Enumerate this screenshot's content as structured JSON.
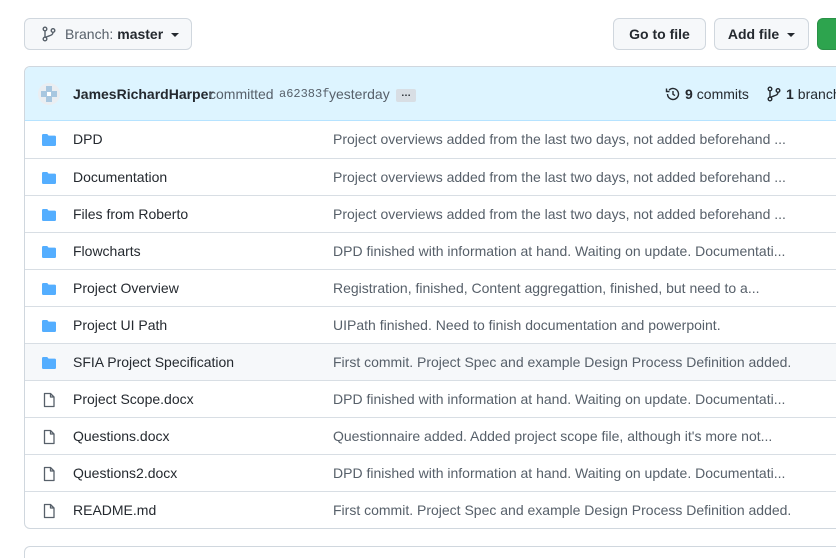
{
  "toolbar": {
    "branch_label": "Branch:",
    "branch_name": "master",
    "goto_label": "Go to file",
    "add_label": "Add file"
  },
  "commit": {
    "author": "JamesRichardHarper",
    "verb": "committed",
    "sha": "a62383f",
    "when": "yesterday",
    "ellipsis": "…",
    "commits_count": "9",
    "commits_label": "commits",
    "branches_count": "1",
    "branches_label": "branch"
  },
  "files": [
    {
      "type": "folder",
      "name": "DPD",
      "message": "Project overviews added from the last two days, not added beforehand ..."
    },
    {
      "type": "folder",
      "name": "Documentation",
      "message": "Project overviews added from the last two days, not added beforehand ..."
    },
    {
      "type": "folder",
      "name": "Files from Roberto",
      "message": "Project overviews added from the last two days, not added beforehand ..."
    },
    {
      "type": "folder",
      "name": "Flowcharts",
      "message": "DPD finished with information at hand. Waiting on update. Documentati..."
    },
    {
      "type": "folder",
      "name": "Project Overview",
      "message": "Registration, finished, Content aggregattion, finished, but need to a..."
    },
    {
      "type": "folder",
      "name": "Project UI Path",
      "message": "UIPath finished. Need to finish documentation and powerpoint."
    },
    {
      "type": "folder",
      "name": "SFIA Project Specification",
      "message": "First commit. Project Spec and example Design Process Definition added."
    },
    {
      "type": "file",
      "name": "Project Scope.docx",
      "message": "DPD finished with information at hand. Waiting on update. Documentati..."
    },
    {
      "type": "file",
      "name": "Questions.docx",
      "message": "Questionnaire added. Added project scope file, although it's more not..."
    },
    {
      "type": "file",
      "name": "Questions2.docx",
      "message": "DPD finished with information at hand. Waiting on update. Documentati..."
    },
    {
      "type": "file",
      "name": "README.md",
      "message": "First commit. Project Spec and example Design Process Definition added."
    }
  ],
  "colors": {
    "folder": "#54aeff",
    "file_icon": "#57606a",
    "header_bg": "#ddf4ff",
    "primary": "#2da44e"
  }
}
